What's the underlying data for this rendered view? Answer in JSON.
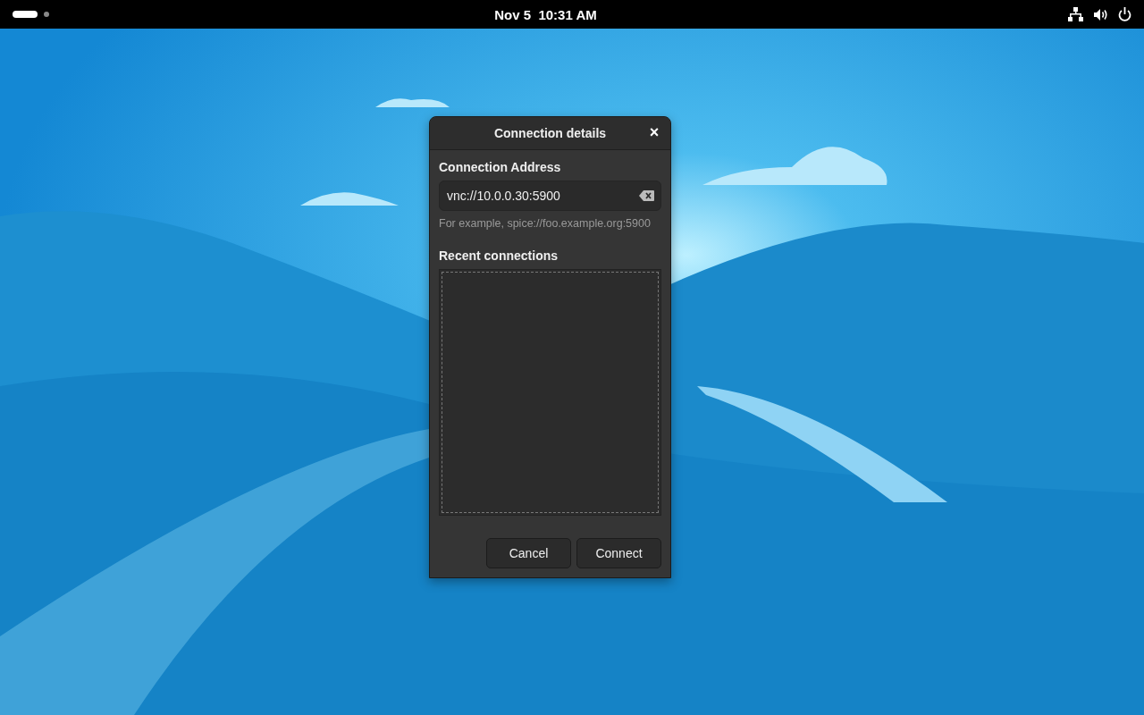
{
  "top_bar": {
    "workspaces": [
      {
        "selected": true
      },
      {
        "selected": false
      }
    ],
    "clock": "Nov 5  10:31 AM"
  },
  "dialog": {
    "title": "Connection details",
    "close": "×",
    "address_label": "Connection Address",
    "address": {
      "value": "vnc://10.0.0.30:5900"
    },
    "hint": "For example, spice://foo.example.org:5900",
    "recent_label": "Recent connections",
    "buttons": [
      "Cancel",
      "Connect"
    ]
  }
}
